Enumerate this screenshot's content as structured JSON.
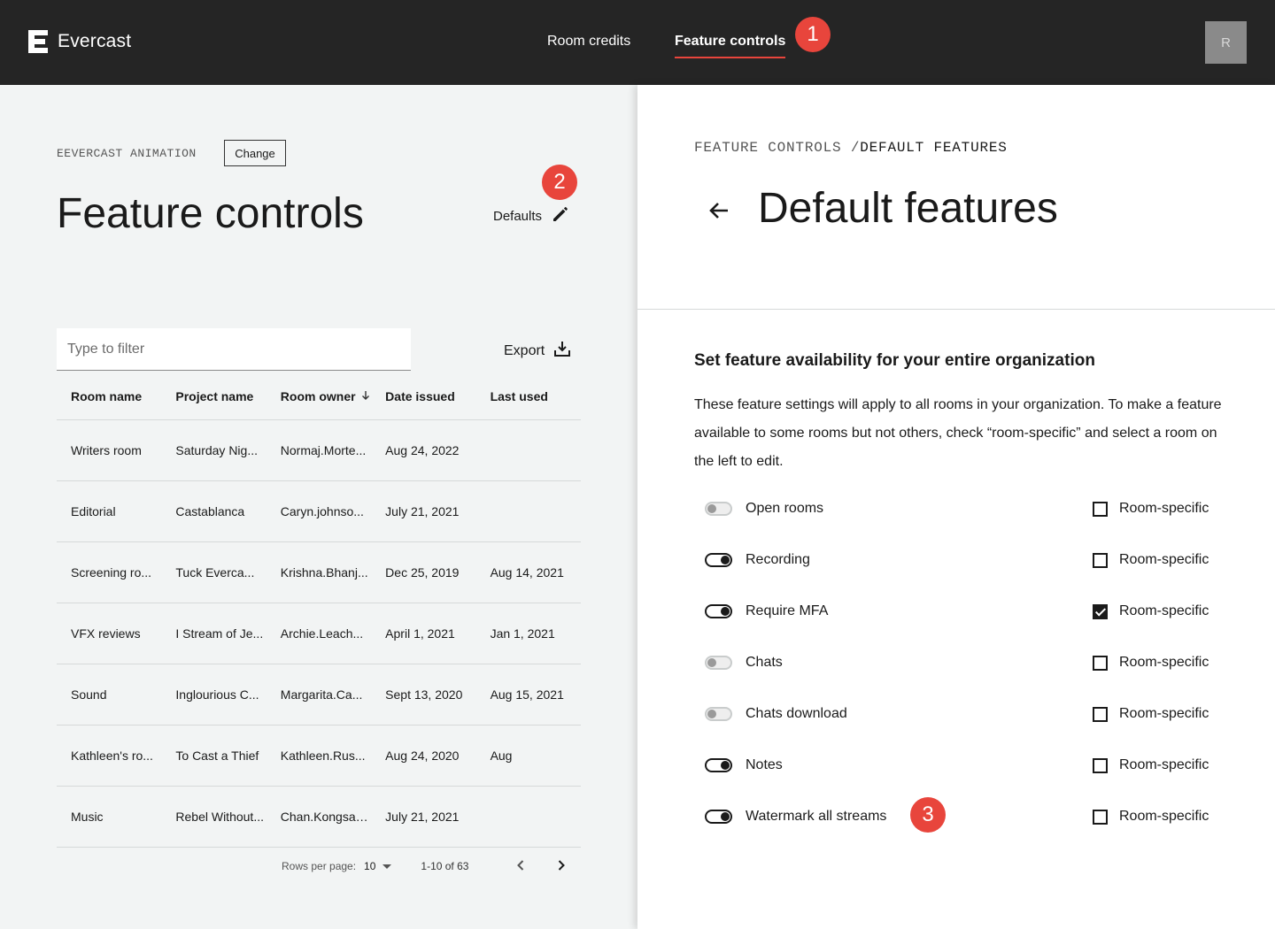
{
  "header": {
    "brand": "Evercast",
    "nav": [
      {
        "label": "Room credits",
        "active": false
      },
      {
        "label": "Feature controls",
        "active": true
      }
    ],
    "avatar_initial": "R",
    "accent_color": "#e8453c"
  },
  "annotations": {
    "one": "1",
    "two": "2",
    "three": "3"
  },
  "left": {
    "org_label": "EEVERCAST ANIMATION",
    "change_label": "Change",
    "title": "Feature controls",
    "defaults_label": "Defaults",
    "filter_placeholder": "Type to filter",
    "export_label": "Export",
    "table": {
      "columns": [
        "Room name",
        "Project name",
        "Room owner",
        "Date issued",
        "Last used"
      ],
      "rows": [
        [
          "Writers room",
          "Saturday Nig...",
          "Normaj.Morte...",
          "Aug 24, 2022",
          ""
        ],
        [
          "Editorial",
          "Castablanca",
          "Caryn.johnso...",
          "July 21, 2021",
          ""
        ],
        [
          "Screening ro...",
          "Tuck Everca...",
          "Krishna.Bhanj...",
          "Dec 25, 2019",
          "Aug 14, 2021"
        ],
        [
          "VFX reviews",
          "I Stream of Je...",
          "Archie.Leach...",
          "April 1, 2021",
          "Jan 1, 2021"
        ],
        [
          "Sound",
          "Inglourious C...",
          "Margarita.Ca...",
          "Sept 13, 2020",
          "Aug 15, 2021"
        ],
        [
          "Kathleen's ro...",
          "To Cast a Thief",
          "Kathleen.Rus...",
          "Aug 24, 2020",
          "Aug"
        ],
        [
          "Music",
          "Rebel Without...",
          "Chan.Kongsan...",
          "July 21, 2021",
          ""
        ]
      ]
    },
    "pagination": {
      "rows_per_page_label": "Rows per page:",
      "rows_per_page": "10",
      "range": "1-10 of 63"
    }
  },
  "right": {
    "breadcrumb_parent": "FEATURE CONTROLS",
    "breadcrumb_sep": "/",
    "breadcrumb_current": "DEFAULT FEATURES",
    "title": "Default features",
    "section_heading": "Set feature availability for your entire organization",
    "section_text": "These feature settings will apply to all rooms in your organization. To make a feature available to some rooms but not others, check “room-specific” and select a room on the left to edit.",
    "features": [
      {
        "label": "Open rooms",
        "enabled": false,
        "room_specific": false,
        "checkbox_label": "Room-specific"
      },
      {
        "label": "Recording",
        "enabled": true,
        "room_specific": false,
        "checkbox_label": "Room-specific"
      },
      {
        "label": "Require MFA",
        "enabled": true,
        "room_specific": true,
        "checkbox_label": "Room-specific"
      },
      {
        "label": "Chats",
        "enabled": false,
        "room_specific": false,
        "checkbox_label": "Room-specific"
      },
      {
        "label": "Chats download",
        "enabled": false,
        "room_specific": false,
        "checkbox_label": "Room-specific"
      },
      {
        "label": "Notes",
        "enabled": true,
        "room_specific": false,
        "checkbox_label": "Room-specific"
      },
      {
        "label": "Watermark all streams",
        "enabled": true,
        "room_specific": false,
        "checkbox_label": "Room-specific"
      }
    ]
  }
}
